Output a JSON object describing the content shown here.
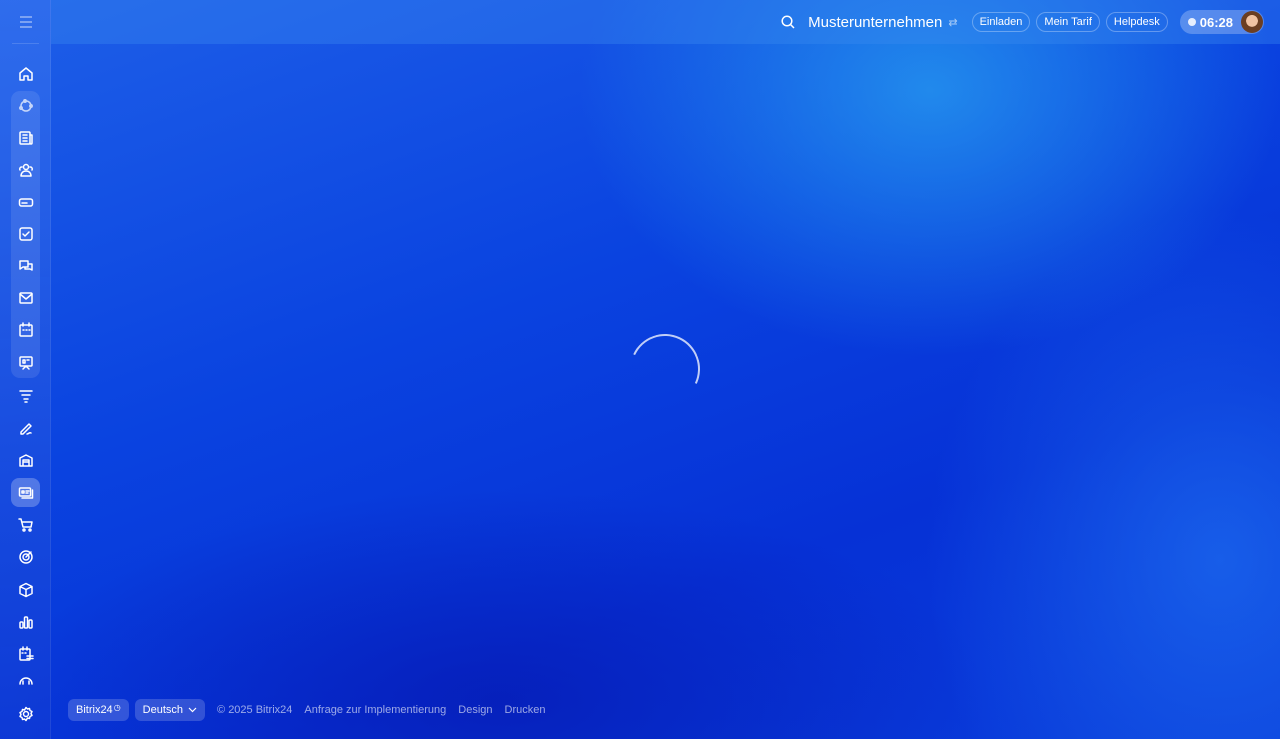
{
  "header": {
    "company": "Musterunternehmen",
    "buttons": [
      "Einladen",
      "Mein Tarif",
      "Helpdesk"
    ],
    "time": "06:28"
  },
  "footer": {
    "brand": "Bitrix24",
    "brand_icon": "clock-icon",
    "language": "Deutsch",
    "copyright": "© 2025 Bitrix24",
    "links": [
      "Anfrage zur Implementierung",
      "Design",
      "Drucken"
    ]
  },
  "sidebar": {
    "icons": [
      "home",
      "feed",
      "news",
      "collaboration",
      "crm-inbox",
      "tasks",
      "messenger",
      "mail",
      "calendar",
      "online-meetings",
      "sales-funnel",
      "sign",
      "warehouse",
      "contact-center",
      "shop",
      "marketing",
      "inventory",
      "analytics",
      "booking",
      "automation",
      "settings"
    ],
    "active": "contact-center"
  },
  "colors": {
    "accent": "#0a43e0"
  }
}
